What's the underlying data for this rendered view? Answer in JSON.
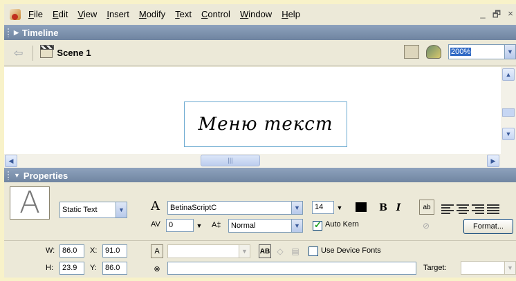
{
  "menu": {
    "items": [
      {
        "key": "F",
        "rest": "ile"
      },
      {
        "key": "E",
        "rest": "dit"
      },
      {
        "key": "V",
        "rest": "iew"
      },
      {
        "key": "I",
        "rest": "nsert"
      },
      {
        "key": "M",
        "rest": "odify"
      },
      {
        "key": "T",
        "rest": "ext"
      },
      {
        "key": "C",
        "rest": "ontrol"
      },
      {
        "key": "W",
        "rest": "indow"
      },
      {
        "key": "H",
        "rest": "elp"
      }
    ],
    "win_min": "_",
    "win_restore": "🗗",
    "win_close": "×"
  },
  "timeline": {
    "title": "Timeline"
  },
  "scenebar": {
    "back_arrow": "⇦",
    "scene_label": "Scene 1",
    "zoom_value": "200%",
    "dropdown_arrow": "▼"
  },
  "stage": {
    "text": "Меню текст"
  },
  "scroll": {
    "up": "▲",
    "down": "▼",
    "left": "◀",
    "right": "▶",
    "thumb_grip": "|||"
  },
  "properties": {
    "title": "Properties",
    "text_type": "Static Text",
    "font_name": "BetinaScriptC",
    "font_size": "14",
    "bold": "B",
    "italic": "I",
    "tracking_label": "A͏V",
    "tracking_value": "0",
    "baseline_label": "A‡",
    "baseline_value": "Normal",
    "auto_kern": "Auto Kern",
    "format_button": "Format...",
    "use_device_fonts": "Use Device Fonts",
    "target_label": "Target:",
    "w_label": "W:",
    "w_value": "86.0",
    "x_label": "X:",
    "x_value": "91.0",
    "h_label": "H:",
    "h_value": "23.9",
    "y_label": "Y:",
    "y_value": "86.0",
    "url_value": ""
  },
  "colors": {
    "title_bar": "#7d91ad",
    "stage_bg": "#ffffff",
    "text_color": "#000000",
    "panel_bg": "#ece9d8"
  }
}
